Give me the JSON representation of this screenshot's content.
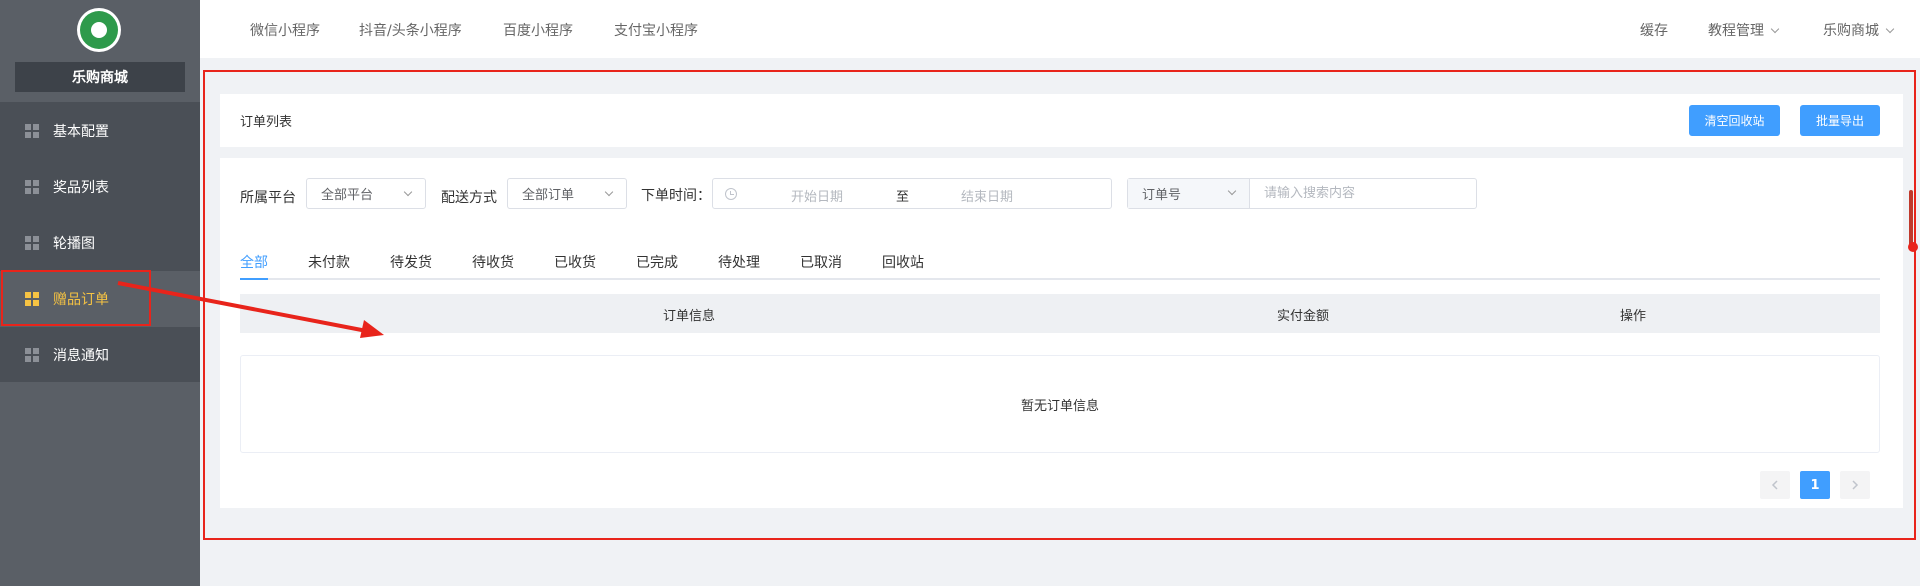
{
  "sidebar": {
    "shop_name": "乐购商城",
    "items": [
      {
        "label": "基本配置",
        "icon": "grid-icon"
      },
      {
        "label": "奖品列表",
        "icon": "grid-icon"
      },
      {
        "label": "轮播图",
        "icon": "grid-icon"
      },
      {
        "label": "赠品订单",
        "icon": "grid-icon",
        "active": true
      },
      {
        "label": "消息通知",
        "icon": "grid-icon"
      }
    ],
    "active_color": "#f6c343"
  },
  "topbar": {
    "left_links": [
      "微信小程序",
      "抖音/头条小程序",
      "百度小程序",
      "支付宝小程序"
    ],
    "right_links": [
      "缓存",
      "教程管理",
      "乐购商城"
    ]
  },
  "page": {
    "title": "订单列表",
    "buttons": {
      "clear_recycle": "清空回收站",
      "batch_export": "批量导出"
    }
  },
  "filters": {
    "platform_label": "所属平台",
    "platform_value": "全部平台",
    "delivery_label": "配送方式",
    "delivery_value": "全部订单",
    "time_label": "下单时间：",
    "start_placeholder": "开始日期",
    "range_sep": "至",
    "end_placeholder": "结束日期",
    "search_type": "订单号",
    "search_placeholder": "请输入搜索内容"
  },
  "tabs": [
    "全部",
    "未付款",
    "待发货",
    "待收货",
    "已收货",
    "已完成",
    "待处理",
    "已取消",
    "回收站"
  ],
  "active_tab": "全部",
  "table": {
    "columns": [
      "订单信息",
      "实付金额",
      "操作"
    ],
    "empty_text": "暂无订单信息"
  },
  "pagination": {
    "current": "1"
  },
  "colors": {
    "primary": "#409eff",
    "annotation": "#e8241b",
    "sidebar_bg": "#5a5f66"
  }
}
